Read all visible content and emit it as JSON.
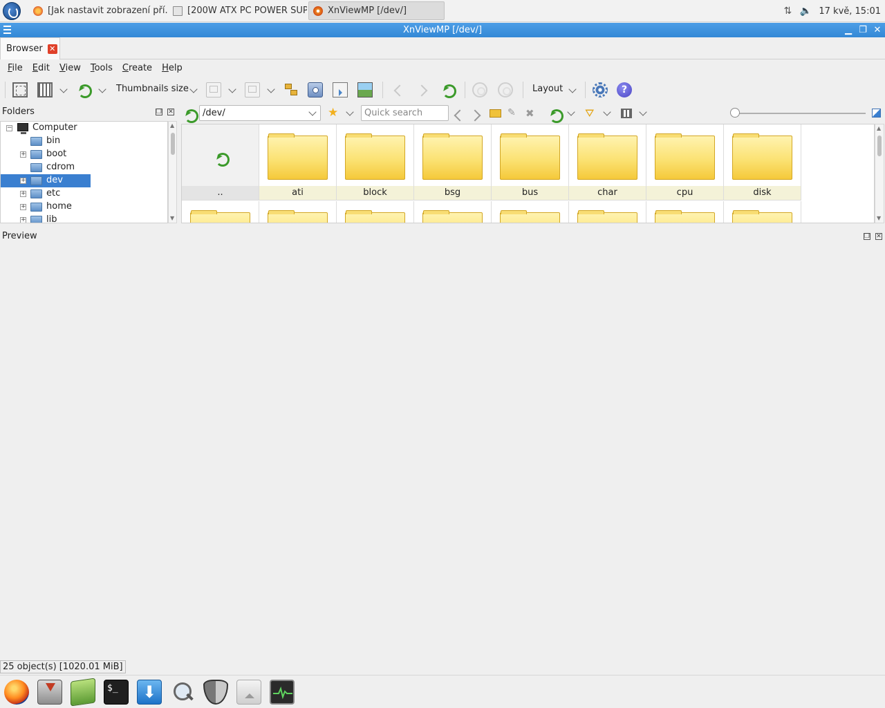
{
  "taskbar": {
    "tasks": [
      {
        "label": "[Jak nastavit zobrazení pří...",
        "icon": "firefox-icon"
      },
      {
        "label": "[200W ATX PC POWER SUP...",
        "icon": "folder-icon"
      },
      {
        "label": "XnViewMP [/dev/]",
        "icon": "xnview-icon"
      }
    ],
    "clock": "17 kvě, 15:01"
  },
  "window": {
    "title": "XnViewMP [/dev/]"
  },
  "tabs": [
    {
      "label": "Browser"
    }
  ],
  "menubar": {
    "items": [
      {
        "label": "File",
        "u": "F",
        "rest": "ile"
      },
      {
        "label": "Edit",
        "u": "E",
        "rest": "dit"
      },
      {
        "label": "View",
        "u": "V",
        "rest": "iew"
      },
      {
        "label": "Tools",
        "u": "T",
        "rest": "ools"
      },
      {
        "label": "Create",
        "u": "C",
        "rest": "reate"
      },
      {
        "label": "Help",
        "u": "H",
        "rest": "elp"
      }
    ]
  },
  "toolbar": {
    "thumbnails_size_label": "Thumbnails size",
    "layout_label": "Layout"
  },
  "folders": {
    "title": "Folders",
    "items": [
      {
        "label": "Computer",
        "level": 0,
        "expander": "−",
        "icon": "computer-icon",
        "selected": false
      },
      {
        "label": "bin",
        "level": 1,
        "expander": "",
        "icon": "folder-icon",
        "selected": false
      },
      {
        "label": "boot",
        "level": 1,
        "expander": "+",
        "icon": "folder-icon",
        "selected": false
      },
      {
        "label": "cdrom",
        "level": 1,
        "expander": "",
        "icon": "folder-icon",
        "selected": false
      },
      {
        "label": "dev",
        "level": 1,
        "expander": "+",
        "icon": "folder-icon",
        "selected": true
      },
      {
        "label": "etc",
        "level": 1,
        "expander": "+",
        "icon": "folder-icon",
        "selected": false
      },
      {
        "label": "home",
        "level": 1,
        "expander": "+",
        "icon": "folder-icon",
        "selected": false
      },
      {
        "label": "lib",
        "level": 1,
        "expander": "+",
        "icon": "folder-icon",
        "selected": false
      }
    ]
  },
  "pathbar": {
    "path": "/dev/",
    "search_placeholder": "Quick search",
    "zoom_level": 0
  },
  "browser": {
    "items": [
      {
        "label": "..",
        "type": "parent"
      },
      {
        "label": "ati",
        "type": "folder"
      },
      {
        "label": "block",
        "type": "folder"
      },
      {
        "label": "bsg",
        "type": "folder"
      },
      {
        "label": "bus",
        "type": "folder"
      },
      {
        "label": "char",
        "type": "folder"
      },
      {
        "label": "cpu",
        "type": "folder"
      },
      {
        "label": "disk",
        "type": "folder"
      }
    ]
  },
  "preview": {
    "title": "Preview"
  },
  "status": {
    "text": "25 object(s) [1020.01 MiB]"
  },
  "dock": {
    "apps": [
      "firefox-icon",
      "installer-icon",
      "package-manager-icon",
      "terminal-icon",
      "download-icon",
      "search-icon",
      "security-shield-icon",
      "home-folder-icon",
      "system-monitor-icon"
    ]
  }
}
